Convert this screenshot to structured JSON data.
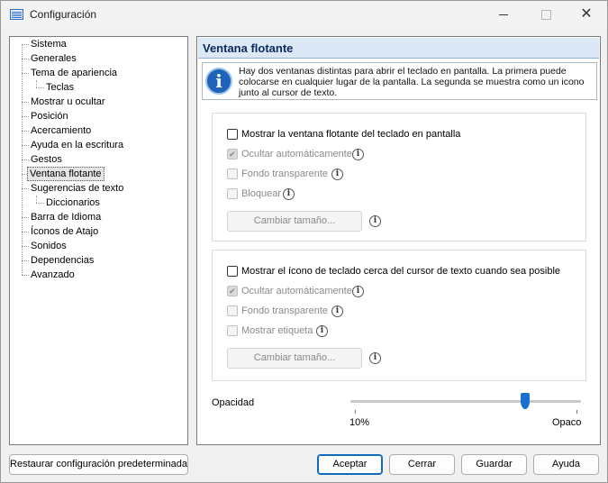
{
  "window": {
    "title": "Configuración"
  },
  "sidebar": {
    "items": [
      {
        "label": "Sistema",
        "level": 0
      },
      {
        "label": "Generales",
        "level": 0
      },
      {
        "label": "Tema de apariencia",
        "level": 0
      },
      {
        "label": "Teclas",
        "level": 1
      },
      {
        "label": "Mostrar u ocultar",
        "level": 0
      },
      {
        "label": "Posición",
        "level": 0
      },
      {
        "label": "Acercamiento",
        "level": 0
      },
      {
        "label": "Ayuda en la escritura",
        "level": 0
      },
      {
        "label": "Gestos",
        "level": 0
      },
      {
        "label": "Ventana flotante",
        "level": 0,
        "selected": true
      },
      {
        "label": "Sugerencias de texto",
        "level": 0
      },
      {
        "label": "Diccionarios",
        "level": 1
      },
      {
        "label": "Barra de Idioma",
        "level": 0
      },
      {
        "label": "Íconos de Atajo",
        "level": 0
      },
      {
        "label": "Sonidos",
        "level": 0
      },
      {
        "label": "Dependencias",
        "level": 0
      },
      {
        "label": "Avanzado",
        "level": 0
      }
    ]
  },
  "panel": {
    "title": "Ventana flotante",
    "info": "Hay dos ventanas distintas para abrir el teclado en pantalla. La primera puede colocarse en cualquier lugar de la pantalla. La segunda se muestra como un icono junto al cursor de texto.",
    "group1": {
      "main_checkbox": {
        "label": "Mostrar la ventana flotante del teclado en pantalla",
        "checked": false
      },
      "options": [
        {
          "label": "Ocultar automáticamente",
          "checked": true,
          "enabled": false
        },
        {
          "label": "Fondo transparente",
          "checked": false,
          "enabled": false
        },
        {
          "label": "Bloquear",
          "checked": false,
          "enabled": false
        }
      ],
      "resize_button": "Cambiar tamaño..."
    },
    "group2": {
      "main_checkbox": {
        "label": "Mostrar el ícono de teclado cerca del cursor de texto cuando sea posible",
        "checked": false
      },
      "options": [
        {
          "label": "Ocultar automáticamente",
          "checked": true,
          "enabled": false
        },
        {
          "label": "Fondo transparente",
          "checked": false,
          "enabled": false
        },
        {
          "label": "Mostrar etiqueta",
          "checked": false,
          "enabled": false
        }
      ],
      "resize_button": "Cambiar tamaño..."
    },
    "opacity": {
      "label": "Opacidad",
      "min_label": "10%",
      "max_label": "Opaco",
      "value_fraction": 0.77
    }
  },
  "footer": {
    "reset": "Restaurar configuración predeterminada",
    "ok": "Aceptar",
    "cancel": "Cerrar",
    "save": "Guardar",
    "help": "Ayuda"
  },
  "colors": {
    "accent": "#0f6cbd",
    "header_bg": "#dce8f6",
    "header_text": "#0b2a5a"
  }
}
